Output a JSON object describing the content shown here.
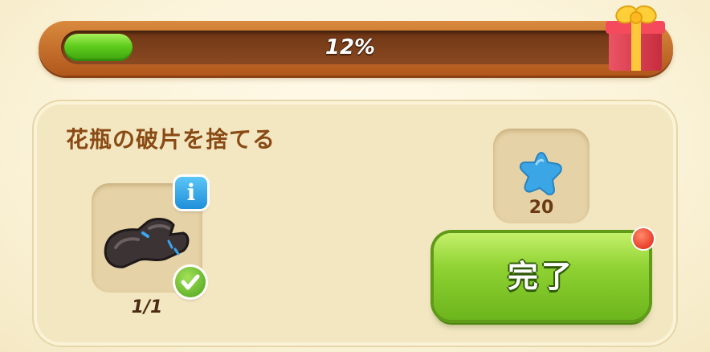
{
  "progress": {
    "percent_value": 0.12,
    "label": "12%"
  },
  "quest": {
    "title": "花瓶の破片を捨てる",
    "item": {
      "icon": "vase-shard-icon",
      "count_label": "1/1",
      "completed": true,
      "info_icon_label": "i"
    },
    "reward": {
      "icon": "blue-star-icon",
      "amount": "20"
    },
    "complete_button": {
      "label": "完了",
      "has_notification": true
    }
  },
  "colors": {
    "progress_green": "#5fcc1c",
    "frame_brown": "#b1571c",
    "title_brown": "#8a4a14",
    "button_green": "#8fd232",
    "notify_red": "#e01e10",
    "info_blue": "#1e8fd9"
  }
}
